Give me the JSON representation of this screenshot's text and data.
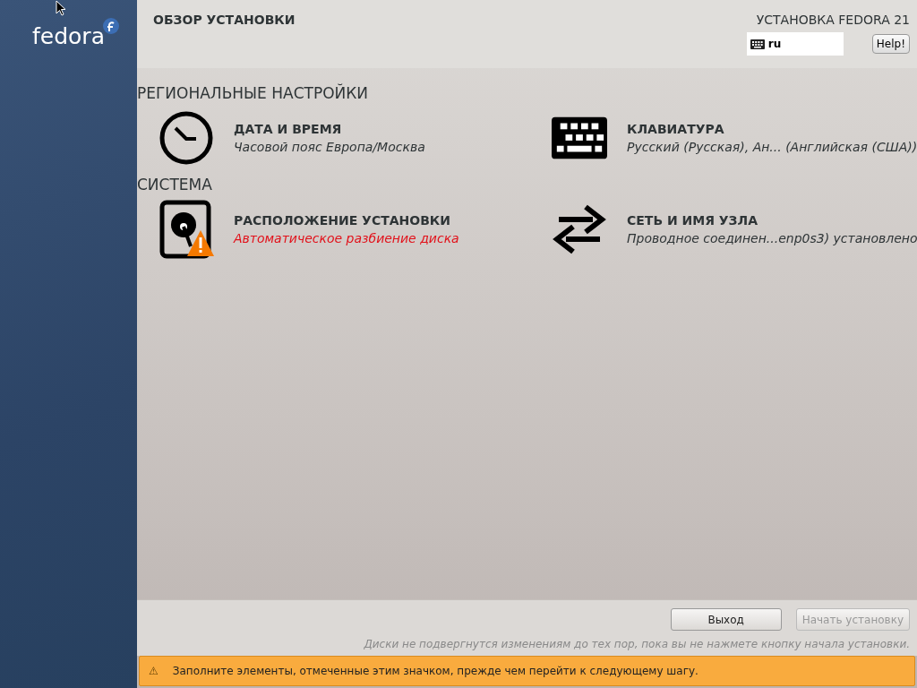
{
  "sidebar": {
    "logo": "fedora"
  },
  "header": {
    "title": "ОБЗОР УСТАНОВКИ",
    "product": "УСТАНОВКА FEDORA 21",
    "layout": "ru",
    "help": "Help!"
  },
  "sections": [
    {
      "title": "РЕГИОНАЛЬНЫЕ НАСТРОЙКИ",
      "spokes": [
        {
          "kind": "clock",
          "title": "ДАТА И ВРЕМЯ",
          "status": "Часовой пояс Европа/Москва",
          "warning": false
        },
        {
          "kind": "keyboard",
          "title": "КЛАВИАТУРА",
          "status": "Русский (Русская), Ан... (Английская (США))",
          "warning": false
        }
      ]
    },
    {
      "title": "СИСТЕМА",
      "spokes": [
        {
          "kind": "disk",
          "title": "РАСПОЛОЖЕНИЕ УСТАНОВКИ",
          "status": "Автоматическое разбиение диска",
          "warning": true
        },
        {
          "kind": "network",
          "title": "СЕТЬ И ИМЯ УЗЛА",
          "status": "Проводное соединен...enp0s3) установлено",
          "warning": false
        }
      ]
    }
  ],
  "buttons": [
    {
      "label": "Выход",
      "disabled": false
    },
    {
      "label": "Начать установку",
      "disabled": true
    }
  ],
  "note": "Диски не подвергнутся изменениям до тех пор, пока вы не нажмете кнопку начала установки.",
  "warning_bar": {
    "icon": "⚠",
    "text": "Заполните элементы, отмеченные этим значком, прежде чем перейти к следующему шагу."
  }
}
